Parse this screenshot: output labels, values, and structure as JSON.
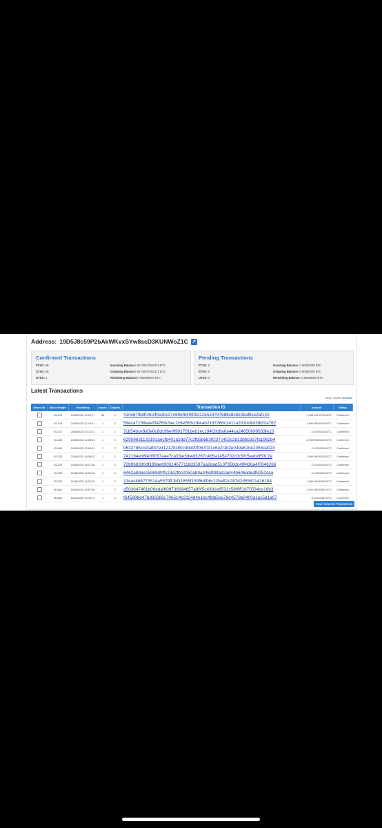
{
  "address": {
    "label": "Address:",
    "value": "19D5J8c59P2bAkWKvxSYw8scD3KUNWoZ1C"
  },
  "confirmed": {
    "title": "Confirmed Transactions",
    "ftxo_label": "FTXO:",
    "ftxo": "49",
    "stxo_label": "STXO:",
    "stxo": "48",
    "utxo_label": "UTXO:",
    "utxo": "1",
    "incoming_label": "Incoming Balance:",
    "incoming": "96,789.97002719 BTC",
    "outgoing_label": "Outgoing Balance:",
    "outgoing": "96,789.97002172 BTC",
    "remaining_label": "Remaining Balance:",
    "remaining": "0.00000547 BTC"
  },
  "pending": {
    "title": "Pending Transactions",
    "ftxo_label": "FTXO:",
    "ftxo": "0",
    "stxo_label": "STXO:",
    "stxo": "0",
    "utxo_label": "UTXO:",
    "utxo": "0",
    "incoming_label": "Incoming Balance:",
    "incoming": "0.00000000 BTC",
    "outgoing_label": "Outgoing Balance:",
    "outgoing": "0.00000000 BTC",
    "remaining_label": "Remaining Balance:",
    "remaining": "0.00000000 BTC"
  },
  "latest": {
    "title": "Latest Transactions",
    "show_label": "Show:",
    "show_opt1": "Inscribe",
    "show_opt2": "Ordinals"
  },
  "table": {
    "headers": [
      "Select All",
      "Block Height",
      "Timestamp",
      "Inputs",
      "Outputs",
      "Transaction ID",
      "Amount",
      "Status"
    ],
    "rows": [
      [
        "911524",
        "24/08/2025 22:20:27",
        "38",
        "1",
        "410c67f9df04c3f0e2bc37c69ef840f053115519797688c8c8235af6cc2af142",
        "-1,968.99191726 BTC",
        "Confirmed"
      ],
      [
        "911518",
        "24/08/2025 21:15:41",
        "1",
        "2",
        "59eca7156eeef34769c9ec2c6e563cd84ab2187268c2411a201bd8d380f2a767",
        "-3,999.99000226 BTC",
        "Confirmed"
      ],
      [
        "911517",
        "24/08/2025 21:14:11",
        "1",
        "2",
        "7cb54bce8a5e0c8dc96e0f991701beb1ec194f2fd9a6a44ca24050698633fe10",
        "-0.10000226 BTC",
        "Confirmed"
      ],
      [
        "911460",
        "24/08/2025 12:58:51",
        "1",
        "2",
        "62959631132191aecfb401a2dd77c2fb5b6b30237c452c2d13bbb3a7fa1962b4",
        "-5,999.99000226 BTC",
        "Confirmed"
      ],
      [
        "911460",
        "24/08/2025 12:58:51",
        "1",
        "2",
        "0632785cccfa837ed12120c80c3bb00f087031c6e2f1b2e049a610e2363ca024",
        "-0.01000226 BTC",
        "Confirmed"
      ],
      [
        "911332",
        "23/08/2025 16:58:52",
        "1",
        "2",
        "742194eb8fe0f0f37aae7ca33ac9b4d3267c4b5a145e702c0c9fc5eebdf53c7e",
        "-3,999.99000226 BTC",
        "Confirmed"
      ],
      [
        "911329",
        "23/08/2025 16:27:38",
        "1",
        "2",
        "72b968380df199ae890314677118d3587aa2dad5107956dc49f436a4f7846266",
        "-0.01000226 BTC",
        "Confirmed"
      ],
      [
        "911032",
        "21/08/2025 16:52:32",
        "1",
        "2",
        "6462a8deec5969df4fc23e2fbc0050ab9a3463fd9ab2ad44b606adedf6252caa",
        "-0.01000226 BTC",
        "Confirmed"
      ],
      [
        "911032",
        "21/08/2025 16:52:32",
        "1",
        "2",
        "13eac466773514a5579ff fbf11655f159f6df06c22beff2c287d2d55821416184",
        "-4,999.99000226 BTC",
        "Confirmed"
      ],
      [
        "910261",
        "16/08/2025 10:57:56",
        "1",
        "2",
        "d503647461b06edaf608736694657a86f5c4381e6531c58f9ff1b70534ce16b3",
        "-3,000.00000452 BTC",
        "Confirmed"
      ],
      [
        "910260",
        "16/08/2025 10:40:21",
        "1",
        "2",
        "f645898d47bd93286c706514b2324d4e1bc4fdb5ea78d4578a0400a1ac5d1a07",
        "-0.01000452 BTC",
        "Confirmed"
      ]
    ]
  },
  "open_button": "Open Selected Transactions"
}
